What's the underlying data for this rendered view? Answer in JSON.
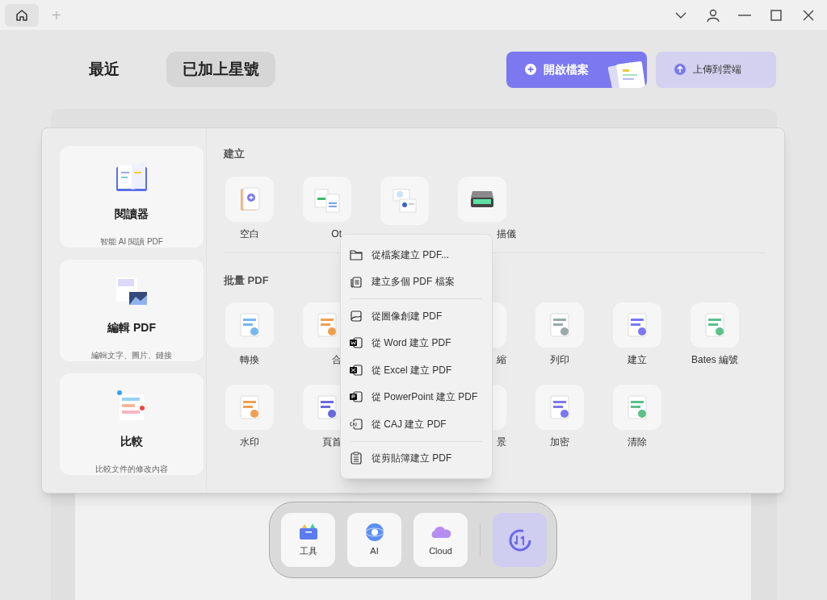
{
  "top_tabs": {
    "plus": "+"
  },
  "view_tabs": [
    {
      "label": "最近",
      "selected": false
    },
    {
      "label": "已加上星號",
      "selected": true
    }
  ],
  "actions": [
    {
      "label": "開啟檔案",
      "kind": "primary"
    },
    {
      "label": "上傳到雲端",
      "kind": "secondary"
    }
  ],
  "side_cards": [
    {
      "title": "閱讀器",
      "subtitle": "智能 AI 閱讀 PDF"
    },
    {
      "title": "編輯 PDF",
      "subtitle": "編輯文字、圖片、鏈接"
    },
    {
      "title": "比較",
      "subtitle": "比較文件的修改內容"
    }
  ],
  "create": {
    "heading": "建立",
    "tiles": [
      {
        "kind": "page",
        "label": "空白"
      },
      {
        "kind": "stack",
        "label": "Ot"
      },
      {
        "kind": "card"
      },
      {
        "kind": "scanner",
        "label": "描儀"
      }
    ]
  },
  "batch": {
    "heading": "批量 PDF",
    "rows": [
      [
        {
          "label": "轉換"
        },
        {
          "label": "合"
        },
        null,
        {
          "label": "縮"
        },
        {
          "label": "列印"
        },
        {
          "label": "建立"
        },
        {
          "label": "Bates 編號"
        }
      ],
      [
        {
          "label": "水印"
        },
        {
          "label": "頁首"
        },
        null,
        {
          "label": "景"
        },
        {
          "label": "加密"
        },
        {
          "label": "清除"
        }
      ]
    ]
  },
  "menu": {
    "groups": [
      [
        "從檔案建立 PDF...",
        "建立多個 PDF 檔案"
      ],
      [
        "從圖像創建 PDF",
        "從 Word 建立 PDF",
        "從 Excel 建立 PDF",
        "從 PowerPoint 建立 PDF",
        "從 CAJ 建立 PDF"
      ],
      [
        "從剪貼簿建立 PDF"
      ]
    ]
  },
  "dock": [
    {
      "label": "工具"
    },
    {
      "label": "AI"
    },
    {
      "label": "Cloud"
    }
  ]
}
